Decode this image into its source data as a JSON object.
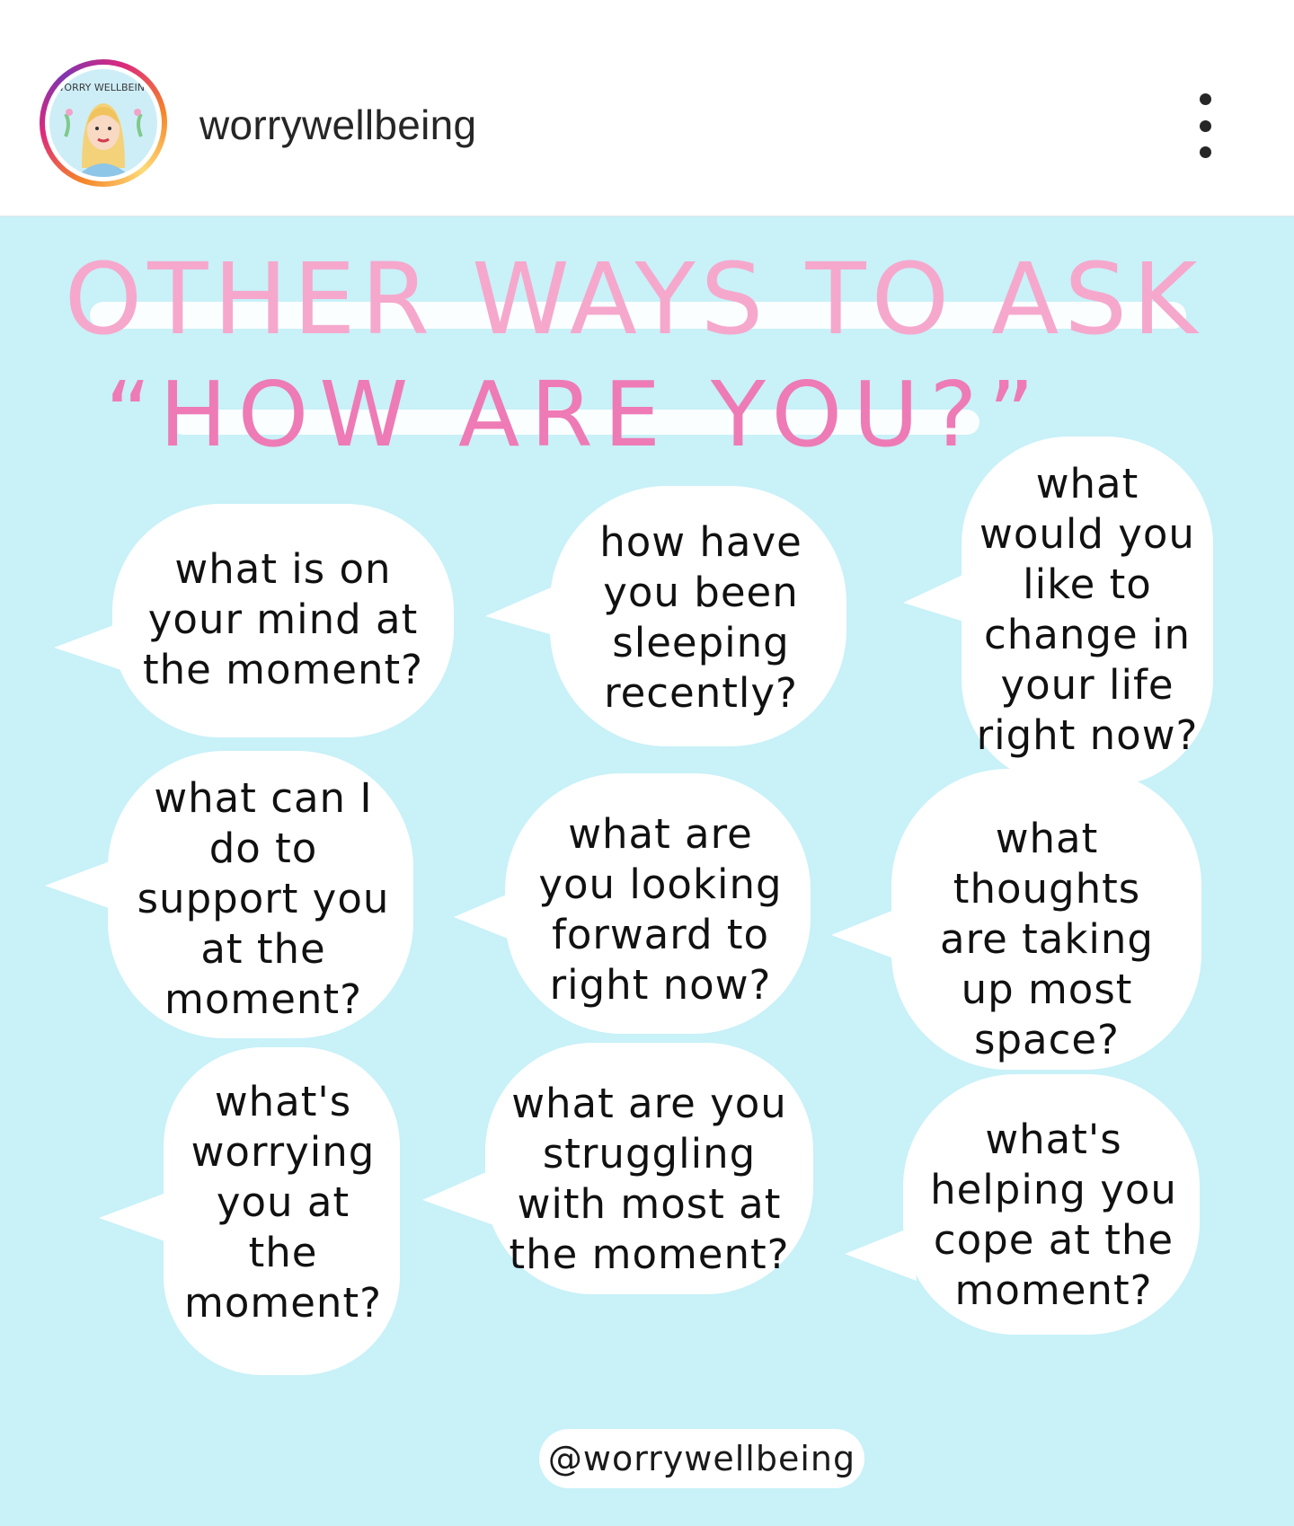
{
  "header": {
    "avatar_text": "WORRY WELLBEING",
    "username": "worrywellbeing",
    "more_icon": "more-vertical-icon"
  },
  "post": {
    "title_line1": "OTHER WAYS TO ASK",
    "title_line2": "“HOW ARE YOU?”",
    "questions": [
      "what is on your mind at the moment?",
      "how have you been sleeping recently?",
      "what would you like to change in your life right now?",
      "what can I do to support you at the moment?",
      "what are you looking forward to right now?",
      "what thoughts are taking up most space?",
      "what's worrying you at the moment?",
      "what are you struggling with most at the moment?",
      "what's helping you cope at the moment?"
    ],
    "handle": "@worrywellbeing",
    "colors": {
      "background": "#c8f1f8",
      "title_pink": "#f29cc4",
      "title_pink_dark": "#e36aa5",
      "bubble": "#ffffff"
    }
  }
}
